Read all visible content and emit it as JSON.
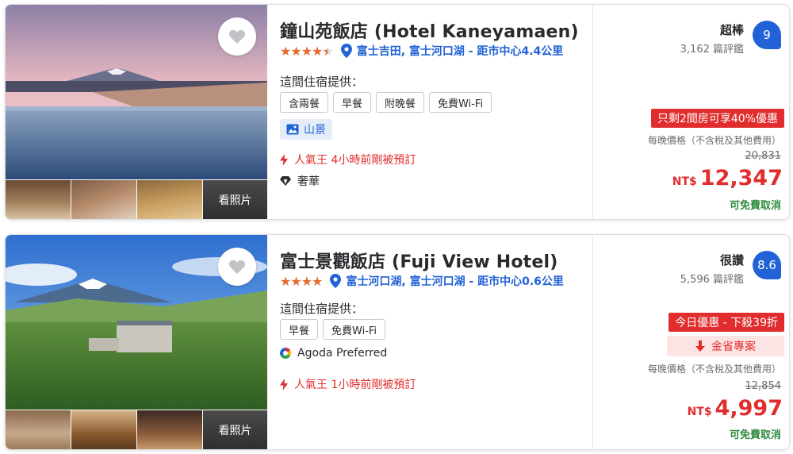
{
  "hotels": [
    {
      "name": "鐘山苑飯店 (Hotel Kaneyamaen)",
      "star_rating": 4.5,
      "location": "富士吉田, 富士河口湖 - 距市中心4.4公里",
      "offers_label": "這間住宿提供：",
      "amenities": [
        "含兩餐",
        "早餐",
        "附晚餐",
        "免費Wi-Fi"
      ],
      "view_tag": "山景",
      "popularity": "人氣王 4小時前剛被預訂",
      "category": "奢華",
      "see_photos": "看照片",
      "review_word": "超棒",
      "review_score": "9",
      "review_count": "3,162 篇評鑑",
      "deal": "只剩2間房可享40%優惠",
      "price_note": "每晚價格（不含稅及其他費用）",
      "original_price": "20,831",
      "currency": "NT$",
      "price": "12,347",
      "cancellation": "可免費取消"
    },
    {
      "name": "富士景觀飯店 (Fuji View Hotel)",
      "star_rating": 4,
      "location": "富士河口湖, 富士河口湖 - 距市中心0.6公里",
      "offers_label": "這間住宿提供：",
      "amenities": [
        "早餐",
        "免費Wi-Fi"
      ],
      "preferred": "Agoda Preferred",
      "popularity": "人氣王 1小時前剛被預訂",
      "see_photos": "看照片",
      "review_word": "很讚",
      "review_score": "8.6",
      "review_count": "5,596 篇評鑑",
      "deal": "今日優惠 - 下殺39折",
      "secret_deal": "金省專案",
      "price_note": "每晚價格（不含稅及其他費用）",
      "original_price": "12,854",
      "currency": "NT$",
      "price": "4,997",
      "cancellation": "可免費取消"
    }
  ],
  "colors": {
    "accent_blue": "#2162d6",
    "price_red": "#e12d2d",
    "star_orange": "#e46a2e",
    "cancel_green": "#2e8b3e"
  },
  "icons": [
    "heart-icon",
    "location-pin-icon",
    "star-icon",
    "image-icon",
    "lightning-icon",
    "diamond-icon",
    "agoda-preferred-icon",
    "arrow-down-icon"
  ]
}
